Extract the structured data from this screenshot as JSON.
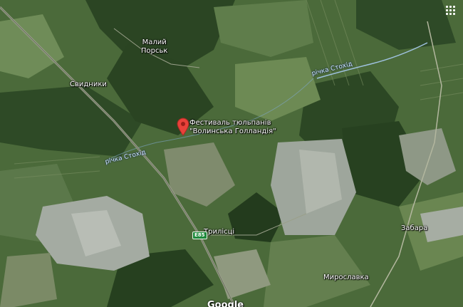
{
  "map": {
    "type": "satellite",
    "colors": {
      "forest": "#2f4a26",
      "field": "#5e7a48",
      "snowfield": "#a7aea6",
      "road": "#8a8f78",
      "river": "#9fc2e0",
      "pin": "#e8413a"
    }
  },
  "places": {
    "maly_porsk_line1": "Малий",
    "maly_porsk_line2": "Порськ",
    "svydnyky": "Свидники",
    "tryliski": "Трилісці",
    "zabara": "Забара",
    "myroslavka": "Мирославка"
  },
  "rivers": {
    "stokhid_north": "річка Стохід",
    "stokhid_west": "річка Стохід"
  },
  "poi": {
    "name_line1": "Фестиваль тюльпанів",
    "name_line2": "\"Волинська Голландія\"",
    "icon": "map-pin-icon"
  },
  "road_shield": "E85",
  "controls": {
    "grid_icon": "grid-icon"
  },
  "attribution": "Google"
}
